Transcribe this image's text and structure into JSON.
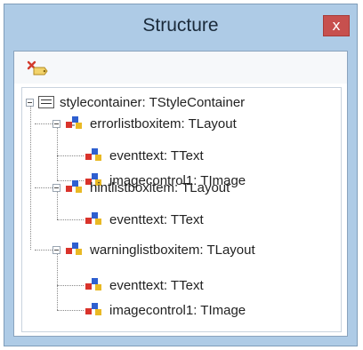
{
  "window": {
    "title": "Structure",
    "close_glyph": "x"
  },
  "toolbar": {
    "delete_icon": "delete-icon"
  },
  "tree": {
    "root": {
      "label": "stylecontainer: TStyleContainer",
      "icon": "style-container-icon"
    },
    "groups": [
      {
        "label": "errorlistboxitem: TLayout",
        "icon": "component-icon",
        "children": [
          {
            "label": "eventtext: TText",
            "icon": "component-icon"
          },
          {
            "label": "imagecontrol1: TImage",
            "icon": "component-icon"
          }
        ]
      },
      {
        "label": "hintlistboxitem: TLayout",
        "icon": "component-icon",
        "children": [
          {
            "label": "eventtext: TText",
            "icon": "component-icon"
          }
        ]
      },
      {
        "label": "warninglistboxitem: TLayout",
        "icon": "component-icon",
        "children": [
          {
            "label": "eventtext: TText",
            "icon": "component-icon"
          },
          {
            "label": "imagecontrol1: TImage",
            "icon": "component-icon"
          }
        ]
      }
    ]
  }
}
